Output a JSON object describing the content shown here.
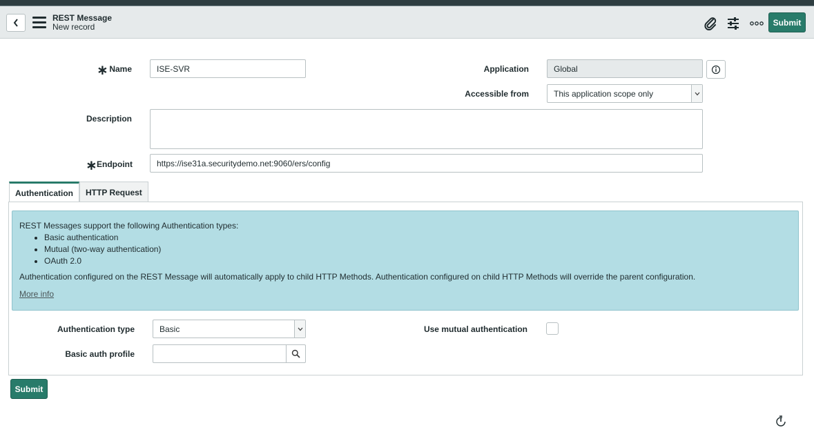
{
  "header": {
    "title": "REST Message",
    "subtitle": "New record",
    "submit_label": "Submit",
    "icons": [
      "paperclip-icon",
      "settings-sliders-icon",
      "more-options-icon"
    ]
  },
  "form": {
    "name": {
      "label": "Name",
      "value": "ISE-SVR",
      "required_mark": "∗"
    },
    "application": {
      "label": "Application",
      "value": "Global"
    },
    "accessible_from": {
      "label": "Accessible from",
      "value": "This application scope only"
    },
    "description": {
      "label": "Description",
      "value": ""
    },
    "endpoint": {
      "label": "Endpoint",
      "value": "https://ise31a.securitydemo.net:9060/ers/config",
      "required_mark": "∗"
    }
  },
  "tabs": [
    {
      "label": "Authentication",
      "active": true
    },
    {
      "label": "HTTP Request",
      "active": false
    }
  ],
  "notice": {
    "intro": "REST Messages support the following Authentication types:",
    "types": [
      "Basic authentication",
      "Mutual (two-way authentication)",
      "OAuth 2.0"
    ],
    "body": "Authentication configured on the REST Message will automatically apply to child HTTP Methods. Authentication configured on child HTTP Methods will override the parent configuration.",
    "link": "More info"
  },
  "auth": {
    "type_label": "Authentication type",
    "type_value": "Basic",
    "profile_label": "Basic auth profile",
    "profile_value": "",
    "mutual_label": "Use mutual authentication",
    "mutual_checked": false
  },
  "footer": {
    "submit_label": "Submit"
  },
  "colors": {
    "accent": "#287b6a",
    "notice_bg": "#b3dde4",
    "header_bg": "#e6eaeb"
  }
}
